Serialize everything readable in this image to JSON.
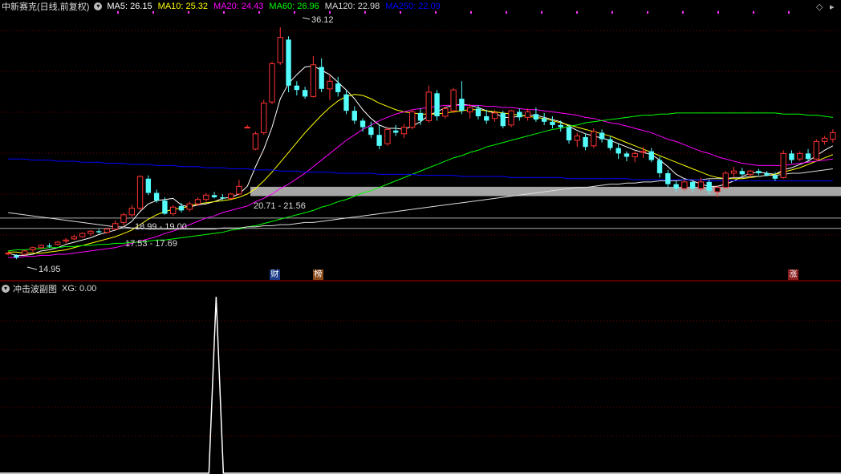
{
  "header": {
    "title": "中新赛克(日线,前复权)",
    "ma": [
      {
        "label": "MA5: 26.15",
        "color": "#ffffff"
      },
      {
        "label": "MA10: 25.32",
        "color": "#ffff00"
      },
      {
        "label": "MA20: 24.43",
        "color": "#ff00ff"
      },
      {
        "label": "MA60: 26.96",
        "color": "#00ff00"
      },
      {
        "label": "MA120: 22.98",
        "color": "#dddddd"
      },
      {
        "label": "MA250: 22.09",
        "color": "#0000ff"
      }
    ]
  },
  "price_labels": {
    "high": "36.12",
    "low": "14.95",
    "range1": "20.71 - 21.56",
    "range2": "18.99 - 19.00",
    "range3": "17.53 - 17.69"
  },
  "events": [
    {
      "label": "财",
      "color": "#1e3c8c"
    },
    {
      "label": "榜",
      "color": "#8a4a1a"
    },
    {
      "label": "涨",
      "color": "#8c1e1e"
    }
  ],
  "sub_panel": {
    "title": "冲击波副图",
    "indicator": "XG: 0.00"
  },
  "colors": {
    "up": "#ff3232",
    "down": "#54fcfc",
    "ma5": "#ffffff",
    "ma10": "#ffff00",
    "ma20": "#ff00ff",
    "ma60": "#00ff00",
    "ma120": "#dddddd",
    "ma250": "#0000ff",
    "grid": "#7a0000",
    "band": "#a6a6a6"
  },
  "chart_data": {
    "type": "candlestick",
    "candles": [
      [
        15.5,
        15.6,
        15.3,
        15.5
      ],
      [
        15.3,
        15.4,
        14.95,
        15.1
      ],
      [
        15.4,
        15.8,
        15.3,
        15.7
      ],
      [
        15.8,
        16.1,
        15.6,
        16.0
      ],
      [
        16.0,
        16.3,
        15.9,
        16.2
      ],
      [
        16.2,
        16.4,
        16.0,
        16.1
      ],
      [
        16.3,
        16.6,
        16.2,
        16.5
      ],
      [
        16.6,
        16.9,
        16.4,
        16.7
      ],
      [
        16.8,
        17.2,
        16.7,
        17.0
      ],
      [
        17.0,
        17.4,
        16.9,
        17.3
      ],
      [
        17.3,
        17.6,
        17.1,
        17.5
      ],
      [
        17.5,
        17.7,
        17.3,
        17.4
      ],
      [
        17.4,
        17.8,
        17.3,
        17.7
      ],
      [
        17.7,
        18.5,
        17.6,
        18.2
      ],
      [
        18.3,
        19.2,
        18.0,
        19.0
      ],
      [
        19.0,
        19.9,
        18.8,
        19.6
      ],
      [
        19.6,
        22.6,
        19.4,
        22.5
      ],
      [
        22.3,
        22.6,
        20.8,
        21.0
      ],
      [
        21.0,
        21.3,
        20.1,
        20.3
      ],
      [
        20.3,
        20.6,
        19.0,
        19.1
      ],
      [
        19.1,
        19.9,
        18.9,
        19.7
      ],
      [
        19.8,
        20.1,
        19.2,
        19.4
      ],
      [
        19.5,
        20.2,
        19.3,
        20.0
      ],
      [
        20.0,
        20.6,
        19.8,
        20.4
      ],
      [
        20.4,
        21.0,
        20.2,
        20.8
      ],
      [
        20.8,
        21.1,
        20.5,
        20.6
      ],
      [
        20.6,
        20.9,
        20.3,
        20.5
      ],
      [
        20.5,
        21.0,
        20.4,
        20.9
      ],
      [
        20.9,
        22.2,
        20.8,
        21.6
      ],
      [
        27.0,
        27.2,
        26.9,
        27.0
      ],
      [
        25.0,
        26.6,
        24.9,
        26.4
      ],
      [
        26.5,
        29.5,
        26.3,
        29.2
      ],
      [
        29.3,
        33.0,
        29.1,
        32.8
      ],
      [
        32.9,
        36.12,
        32.7,
        35.2
      ],
      [
        35.0,
        35.3,
        30.2,
        30.8
      ],
      [
        30.8,
        31.2,
        29.9,
        30.4
      ],
      [
        30.4,
        30.7,
        29.6,
        29.8
      ],
      [
        29.8,
        33.5,
        29.7,
        32.7
      ],
      [
        32.5,
        33.3,
        30.2,
        30.5
      ],
      [
        30.5,
        31.8,
        29.5,
        31.2
      ],
      [
        31.0,
        31.6,
        29.8,
        30.2
      ],
      [
        30.0,
        30.4,
        28.2,
        28.5
      ],
      [
        28.5,
        28.9,
        27.3,
        27.6
      ],
      [
        27.6,
        27.8,
        26.6,
        27.0
      ],
      [
        27.0,
        27.5,
        26.0,
        26.3
      ],
      [
        26.3,
        27.2,
        25.0,
        25.3
      ],
      [
        25.5,
        27.0,
        25.3,
        26.8
      ],
      [
        26.7,
        27.2,
        26.2,
        26.5
      ],
      [
        26.4,
        27.3,
        26.0,
        27.0
      ],
      [
        27.0,
        28.6,
        26.8,
        28.4
      ],
      [
        28.3,
        28.7,
        27.2,
        27.6
      ],
      [
        27.6,
        30.8,
        27.4,
        30.2
      ],
      [
        30.1,
        30.4,
        27.6,
        28.0
      ],
      [
        28.0,
        28.9,
        27.8,
        28.7
      ],
      [
        28.5,
        30.6,
        28.3,
        30.4
      ],
      [
        29.6,
        31.2,
        28.2,
        28.5
      ],
      [
        28.4,
        29.1,
        27.8,
        28.8
      ],
      [
        28.7,
        29.0,
        27.7,
        28.0
      ],
      [
        28.0,
        28.6,
        27.3,
        27.6
      ],
      [
        27.8,
        28.6,
        27.5,
        28.3
      ],
      [
        28.3,
        28.5,
        26.9,
        27.1
      ],
      [
        27.2,
        28.6,
        27.0,
        28.5
      ],
      [
        28.4,
        28.7,
        27.6,
        27.9
      ],
      [
        27.9,
        28.7,
        27.6,
        28.4
      ],
      [
        28.2,
        28.8,
        27.5,
        27.7
      ],
      [
        27.8,
        28.3,
        27.2,
        27.5
      ],
      [
        27.5,
        28.0,
        26.9,
        27.2
      ],
      [
        27.2,
        27.6,
        26.6,
        27.0
      ],
      [
        27.0,
        27.2,
        25.5,
        25.8
      ],
      [
        25.8,
        26.5,
        25.2,
        26.2
      ],
      [
        26.1,
        26.4,
        24.9,
        25.2
      ],
      [
        25.3,
        26.9,
        25.1,
        26.6
      ],
      [
        26.5,
        26.8,
        25.6,
        25.9
      ],
      [
        25.9,
        26.2,
        24.9,
        25.1
      ],
      [
        25.1,
        25.5,
        24.1,
        24.6
      ],
      [
        24.6,
        24.8,
        23.9,
        24.3
      ],
      [
        24.3,
        24.8,
        23.8,
        24.6
      ],
      [
        24.7,
        25.2,
        24.2,
        24.8
      ],
      [
        24.8,
        25.1,
        23.8,
        24.0
      ],
      [
        24.0,
        24.3,
        22.4,
        22.8
      ],
      [
        22.8,
        23.1,
        21.5,
        21.8
      ],
      [
        21.8,
        22.1,
        21.1,
        21.4
      ],
      [
        21.4,
        22.2,
        21.2,
        22.0
      ],
      [
        22.0,
        22.1,
        21.1,
        21.4
      ],
      [
        21.4,
        22.4,
        21.2,
        22.0
      ],
      [
        22.0,
        22.2,
        20.9,
        21.2
      ],
      [
        21.1,
        21.7,
        20.6,
        21.5
      ],
      [
        21.5,
        23.0,
        21.4,
        22.8
      ],
      [
        22.8,
        23.4,
        22.4,
        23.0
      ],
      [
        23.0,
        23.3,
        22.6,
        22.7
      ],
      [
        22.7,
        23.1,
        22.4,
        23.0
      ],
      [
        23.0,
        23.2,
        22.6,
        22.8
      ],
      [
        22.8,
        23.0,
        22.5,
        22.6
      ],
      [
        22.6,
        22.9,
        22.1,
        22.3
      ],
      [
        22.4,
        24.9,
        22.3,
        24.6
      ],
      [
        24.6,
        24.9,
        23.7,
        24.0
      ],
      [
        24.1,
        24.8,
        23.9,
        24.6
      ],
      [
        24.6,
        25.0,
        23.9,
        24.1
      ],
      [
        24.1,
        25.9,
        24.0,
        25.7
      ],
      [
        25.7,
        26.2,
        25.4,
        26.0
      ],
      [
        25.9,
        26.8,
        25.6,
        26.5
      ]
    ],
    "ma_series": [
      {
        "name": "MA5",
        "key": "ma5",
        "values": [
          15.5,
          15.3,
          15.3,
          15.4,
          15.7,
          15.8,
          16.0,
          16.3,
          16.5,
          16.7,
          16.9,
          17.2,
          17.4,
          17.6,
          17.9,
          18.4,
          19.3,
          20.0,
          20.3,
          20.4,
          20.5,
          19.9,
          19.7,
          19.9,
          20.0,
          20.2,
          20.5,
          20.6,
          20.9,
          21.6,
          23.4,
          25.0,
          27.0,
          29.6,
          31.0,
          31.8,
          32.5,
          32.6,
          32.2,
          31.8,
          31.1,
          30.4,
          29.6,
          28.6,
          27.8,
          27.2,
          26.9,
          26.9,
          26.8,
          27.1,
          27.5,
          28.1,
          28.4,
          28.8,
          29.0,
          29.1,
          29.0,
          28.8,
          28.5,
          28.3,
          27.9,
          27.9,
          28.0,
          28.1,
          28.1,
          27.9,
          27.7,
          27.5,
          27.1,
          26.7,
          26.4,
          26.2,
          26.0,
          25.8,
          25.5,
          25.2,
          24.9,
          24.7,
          24.5,
          24.0,
          23.4,
          22.7,
          22.3,
          22.1,
          21.8,
          21.6,
          21.6,
          21.8,
          22.1,
          22.5,
          22.8,
          22.9,
          22.8,
          22.7,
          23.1,
          23.3,
          23.6,
          23.9,
          24.4,
          24.9,
          25.3
        ]
      },
      {
        "name": "MA10",
        "key": "ma10",
        "values": [
          15.6,
          15.6,
          15.5,
          15.5,
          15.5,
          15.6,
          15.7,
          15.8,
          16.0,
          16.2,
          16.4,
          16.6,
          16.8,
          17.0,
          17.3,
          17.6,
          18.1,
          18.6,
          19.0,
          19.3,
          19.5,
          19.6,
          19.8,
          20.0,
          20.1,
          20.2,
          20.3,
          20.4,
          20.6,
          20.9,
          21.4,
          22.1,
          22.9,
          23.8,
          24.7,
          25.6,
          26.5,
          27.3,
          28.1,
          28.8,
          29.4,
          29.8,
          30.0,
          29.9,
          29.6,
          29.2,
          28.9,
          28.6,
          28.4,
          28.3,
          28.2,
          28.2,
          28.2,
          28.3,
          28.4,
          28.5,
          28.6,
          28.6,
          28.5,
          28.4,
          28.3,
          28.2,
          28.1,
          28.0,
          27.9,
          27.8,
          27.6,
          27.4,
          27.2,
          27.0,
          26.8,
          26.6,
          26.4,
          26.2,
          25.9,
          25.6,
          25.3,
          25.0,
          24.7,
          24.4,
          24.1,
          23.8,
          23.5,
          23.2,
          22.9,
          22.6,
          22.4,
          22.3,
          22.3,
          22.3,
          22.4,
          22.5,
          22.6,
          22.7,
          22.9,
          23.1,
          23.3,
          23.6,
          23.9,
          24.2,
          24.5
        ]
      },
      {
        "name": "MA20",
        "key": "ma20",
        "values": [
          15.1,
          15.1,
          15.2,
          15.2,
          15.3,
          15.3,
          15.4,
          15.4,
          15.5,
          15.6,
          15.7,
          15.8,
          15.9,
          16.0,
          16.2,
          16.4,
          16.6,
          16.8,
          17.0,
          17.3,
          17.5,
          17.8,
          18.1,
          18.4,
          18.7,
          18.9,
          19.2,
          19.4,
          19.6,
          19.8,
          20.2,
          20.5,
          20.9,
          21.4,
          21.8,
          22.3,
          22.8,
          23.4,
          24.0,
          24.6,
          25.2,
          25.8,
          26.3,
          26.8,
          27.2,
          27.6,
          27.9,
          28.2,
          28.4,
          28.6,
          28.7,
          28.8,
          28.9,
          29.0,
          29.0,
          29.0,
          29.0,
          29.0,
          28.9,
          28.9,
          28.8,
          28.8,
          28.7,
          28.6,
          28.6,
          28.5,
          28.4,
          28.3,
          28.2,
          28.1,
          27.9,
          27.8,
          27.6,
          27.4,
          27.3,
          27.1,
          26.9,
          26.7,
          26.5,
          26.2,
          25.9,
          25.7,
          25.4,
          25.1,
          24.8,
          24.6,
          24.3,
          24.1,
          23.9,
          23.7,
          23.6,
          23.5,
          23.5,
          23.5,
          23.5,
          23.6,
          23.7,
          23.8,
          23.9,
          24.0,
          24.1
        ]
      },
      {
        "name": "MA60",
        "key": "ma60",
        "values": [
          15.7,
          15.8,
          15.8,
          15.9,
          15.9,
          16.0,
          16.0,
          16.1,
          16.1,
          16.2,
          16.2,
          16.3,
          16.3,
          16.4,
          16.4,
          16.5,
          16.5,
          16.6,
          16.7,
          16.7,
          16.8,
          16.9,
          17.0,
          17.1,
          17.2,
          17.3,
          17.4,
          17.6,
          17.7,
          17.9,
          18.0,
          18.2,
          18.4,
          18.6,
          18.8,
          19.0,
          19.2,
          19.4,
          19.7,
          19.9,
          20.2,
          20.4,
          20.7,
          21.0,
          21.2,
          21.5,
          21.8,
          22.1,
          22.4,
          22.7,
          23.0,
          23.3,
          23.6,
          23.9,
          24.2,
          24.4,
          24.7,
          24.9,
          25.2,
          25.4,
          25.6,
          25.8,
          26.0,
          26.2,
          26.4,
          26.6,
          26.8,
          26.9,
          27.1,
          27.2,
          27.4,
          27.5,
          27.6,
          27.7,
          27.8,
          27.9,
          28.0,
          28.1,
          28.1,
          28.2,
          28.2,
          28.3,
          28.3,
          28.3,
          28.3,
          28.3,
          28.3,
          28.3,
          28.3,
          28.3,
          28.3,
          28.3,
          28.3,
          28.3,
          28.2,
          28.2,
          28.2,
          28.1,
          28.1,
          28.0,
          27.9
        ]
      },
      {
        "name": "MA120",
        "key": "ma120",
        "values": [
          19.2,
          19.1,
          19.0,
          18.9,
          18.8,
          18.7,
          18.6,
          18.5,
          18.4,
          18.3,
          18.2,
          18.1,
          18.0,
          17.9,
          17.9,
          17.8,
          17.8,
          17.7,
          17.7,
          17.7,
          17.7,
          17.7,
          17.7,
          17.7,
          17.7,
          17.7,
          17.8,
          17.8,
          17.8,
          17.9,
          17.9,
          18.0,
          18.0,
          18.1,
          18.1,
          18.2,
          18.3,
          18.3,
          18.4,
          18.5,
          18.6,
          18.7,
          18.8,
          18.9,
          19.0,
          19.1,
          19.2,
          19.3,
          19.4,
          19.5,
          19.6,
          19.7,
          19.8,
          19.9,
          20.0,
          20.1,
          20.2,
          20.3,
          20.4,
          20.5,
          20.6,
          20.7,
          20.8,
          20.9,
          21.0,
          21.1,
          21.2,
          21.3,
          21.4,
          21.5,
          21.5,
          21.6,
          21.7,
          21.8,
          21.8,
          21.9,
          21.9,
          22.0,
          22.0,
          22.1,
          22.1,
          22.1,
          22.2,
          22.2,
          22.2,
          22.3,
          22.3,
          22.3,
          22.4,
          22.4,
          22.5,
          22.5,
          22.6,
          22.6,
          22.7,
          22.8,
          22.8,
          22.9,
          23.0,
          23.1,
          23.2
        ]
      },
      {
        "name": "MA250",
        "key": "ma250",
        "values": [
          24.1,
          24.1,
          24.1,
          24.0,
          24.0,
          24.0,
          23.9,
          23.9,
          23.9,
          23.8,
          23.8,
          23.8,
          23.7,
          23.7,
          23.7,
          23.6,
          23.6,
          23.6,
          23.5,
          23.5,
          23.5,
          23.4,
          23.4,
          23.4,
          23.3,
          23.3,
          23.3,
          23.2,
          23.2,
          23.2,
          23.1,
          23.1,
          23.1,
          23.0,
          23.0,
          23.0,
          22.9,
          22.9,
          22.9,
          22.9,
          22.8,
          22.8,
          22.8,
          22.8,
          22.8,
          22.7,
          22.7,
          22.7,
          22.7,
          22.7,
          22.6,
          22.6,
          22.6,
          22.6,
          22.6,
          22.5,
          22.5,
          22.5,
          22.5,
          22.5,
          22.5,
          22.4,
          22.4,
          22.4,
          22.4,
          22.4,
          22.4,
          22.4,
          22.3,
          22.3,
          22.3,
          22.3,
          22.3,
          22.3,
          22.3,
          22.3,
          22.2,
          22.2,
          22.2,
          22.2,
          22.2,
          22.2,
          22.2,
          22.2,
          22.2,
          22.1,
          22.1,
          22.1,
          22.1,
          22.1,
          22.1,
          22.1,
          22.1,
          22.1,
          22.1,
          22.1,
          22.1,
          22.1,
          22.1,
          22.1,
          22.1
        ]
      }
    ],
    "hlines": [
      {
        "value": 21.56,
        "style": "band"
      },
      {
        "value": 20.71,
        "style": "band"
      },
      {
        "value": 19.0,
        "style": "line"
      },
      {
        "value": 18.2,
        "style": "line"
      }
    ],
    "ylim": [
      14.3,
      37.3
    ],
    "events_index": [
      38,
      44,
      96
    ],
    "sub": {
      "type": "line",
      "spike_index": 26,
      "spike_value": 1,
      "ylim": [
        0,
        1
      ]
    }
  }
}
